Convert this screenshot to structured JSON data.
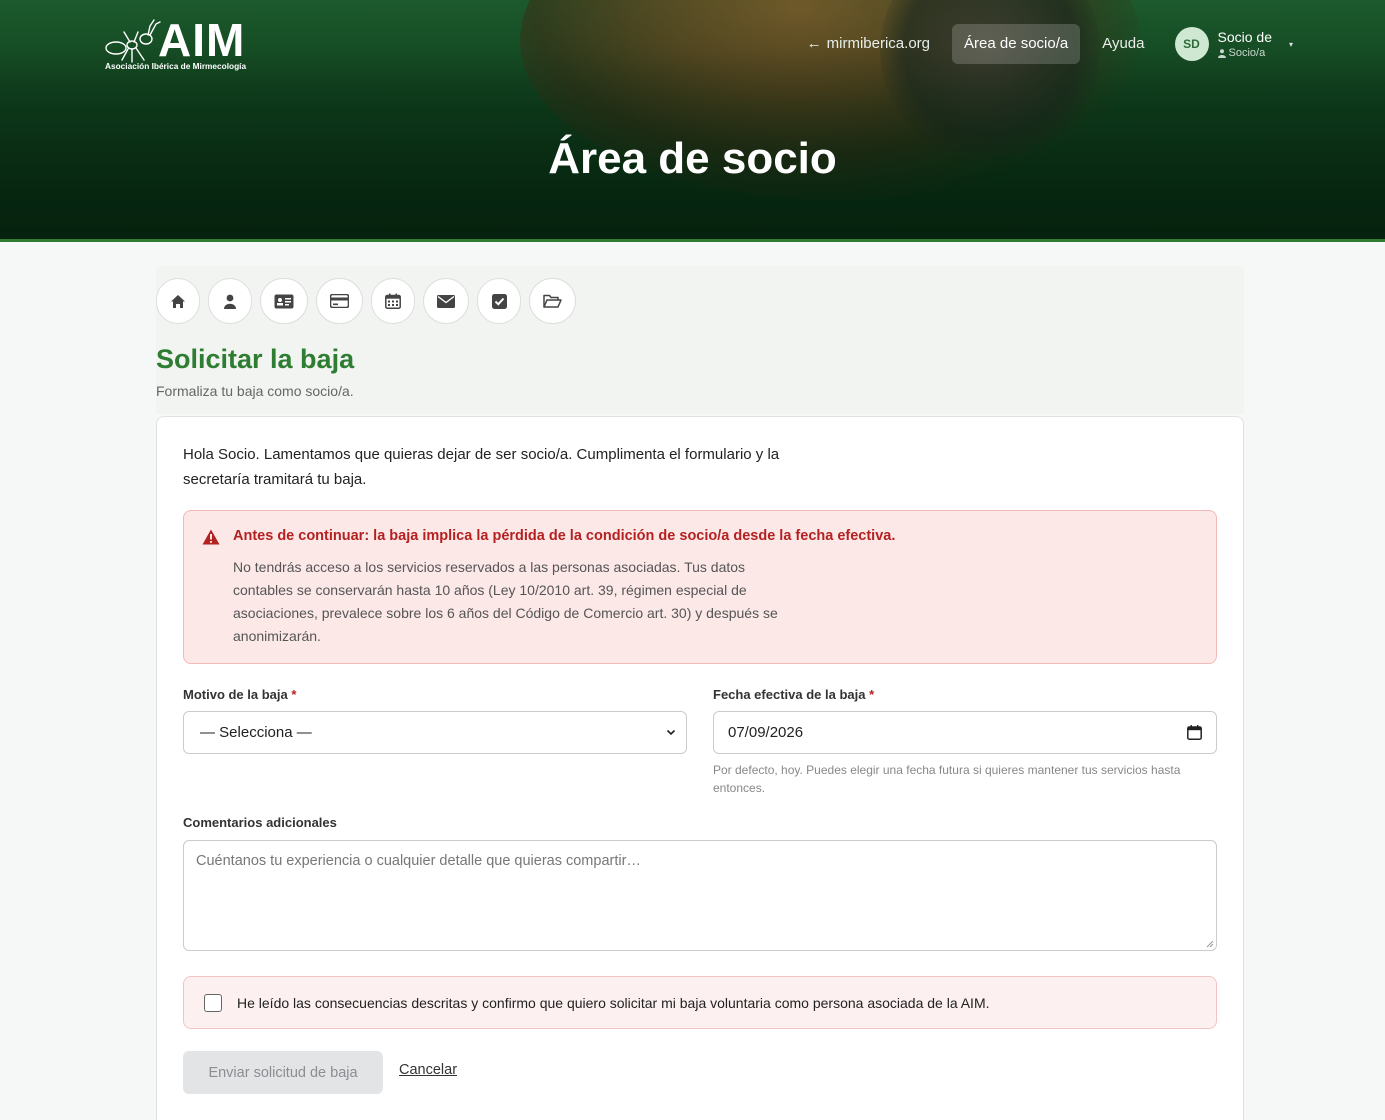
{
  "header": {
    "logo_text": "AIM",
    "logo_subtitle": "Asociación Ibérica de Mirmecología",
    "nav": {
      "back_link": "mirmiberica.org",
      "area_link": "Área de socio/a",
      "help_link": "Ayuda"
    },
    "user": {
      "initials": "SD",
      "name": "Socio de",
      "role": "Socio/a"
    },
    "hero_title": "Área de socio"
  },
  "toolbar": {
    "icons": [
      "home-icon",
      "user-icon",
      "id-card-icon",
      "credit-card-icon",
      "calendar-icon",
      "envelope-icon",
      "check-square-icon",
      "folder-open-icon"
    ]
  },
  "page": {
    "title": "Solicitar la baja",
    "subtitle": "Formaliza tu baja como socio/a."
  },
  "form": {
    "intro": "Hola Socio. Lamentamos que quieras dejar de ser socio/a. Cumplimenta el formulario y la secretaría tramitará tu baja.",
    "alert": {
      "title": "Antes de continuar: la baja implica la pérdida de la condición de socio/a desde la fecha efectiva.",
      "body": "No tendrás acceso a los servicios reservados a las personas asociadas. Tus datos contables se conservarán hasta 10 años (Ley 10/2010 art. 39, régimen especial de asociaciones, prevalece sobre los 6 años del Código de Comercio art. 30) y después se anonimizarán."
    },
    "reason": {
      "label": "Motivo de la baja",
      "required_mark": "*",
      "selected": "— Selecciona —"
    },
    "date": {
      "label": "Fecha efectiva de la baja",
      "required_mark": "*",
      "value": "07/09/2026",
      "help": "Por defecto, hoy. Puedes elegir una fecha futura si quieres mantener tus servicios hasta entonces."
    },
    "comments": {
      "label": "Comentarios adicionales",
      "placeholder": "Cuéntanos tu experiencia o cualquier detalle que quieras compartir…"
    },
    "confirm_text": "He leído las consecuencias descritas y confirmo que quiero solicitar mi baja voluntaria como persona asociada de la AIM.",
    "submit_label": "Enviar solicitud de baja",
    "cancel_label": "Cancelar"
  },
  "colors": {
    "brand_green": "#2e7d32",
    "alert_red": "#b42121",
    "alert_bg": "#fde8e8"
  }
}
